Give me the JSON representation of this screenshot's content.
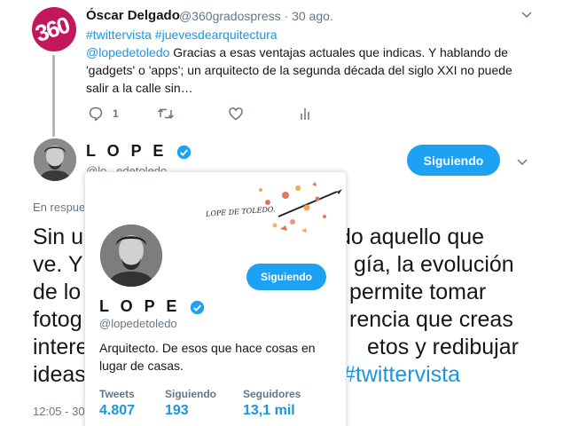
{
  "tweet1": {
    "name": "Óscar Delgado",
    "handle": "@360gradospress",
    "separator": "·",
    "date": "30 ago.",
    "hashtags": "#twittervista #juevesdearquitectura",
    "mention": "@lopedetoledo",
    "body": " Gracias a esas ventajas actuales que indicas. Y hablando de 'gadgets' o 'apps'; un arquitecto de la segunda década del siglo XXI no puede salir a la calle sin…",
    "reply_count": "1",
    "avatar_text": "360"
  },
  "tweet2": {
    "name": "L O P E",
    "handle": "@lo...edetoledo",
    "follow_label": "Siguiendo",
    "reply_to": "En respue",
    "lines": [
      {
        "text": "Sin u",
        "text2": "do aquello que"
      },
      {
        "text": "ve. Y",
        "text2": "gía, la evolución"
      },
      {
        "text": "de lo",
        "text2": "permite tomar"
      },
      {
        "text": "fotog",
        "text2": "rencia que creas"
      },
      {
        "text": "intere",
        "text2": "etos y redibujar"
      },
      {
        "text": "ideas",
        "text2": "#twittervista"
      }
    ],
    "time": "12:05 - 30"
  },
  "card": {
    "banner_text": "LOPE DE TOLEDO.",
    "follow_label": "Siguiendo",
    "name": "L O P E",
    "handle": "@lopedetoledo",
    "bio": "Arquitecto. De esos que hace cosas en lugar de casas.",
    "stats": [
      {
        "label": "Tweets",
        "value": "4.807"
      },
      {
        "label": "Siguiendo",
        "value": "193"
      },
      {
        "label": "Seguidores",
        "value": "13,1 mil"
      }
    ]
  },
  "colors": {
    "accent": "#1da1f2",
    "link": "#1b95e0",
    "muted": "#657786",
    "brand_360": "#c2185b"
  }
}
